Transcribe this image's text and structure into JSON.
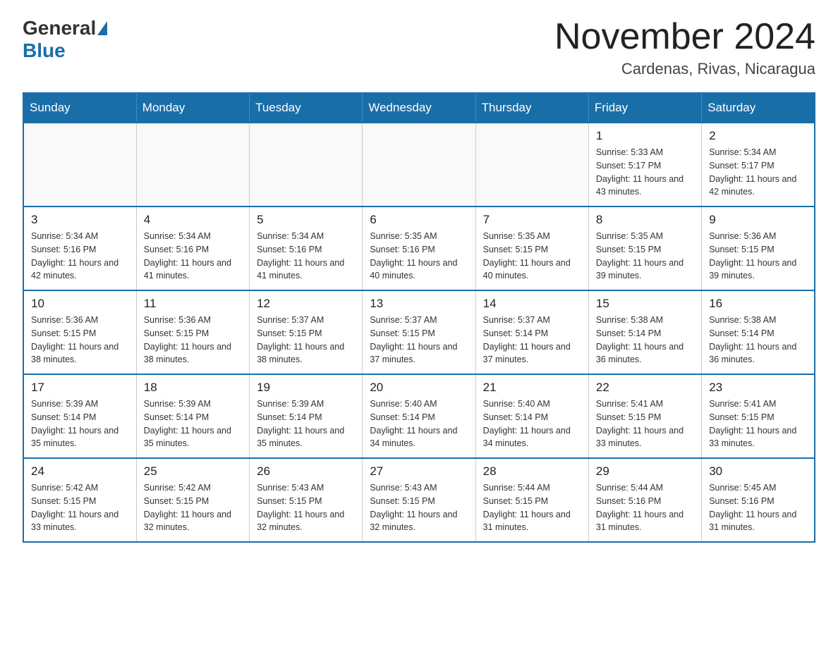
{
  "header": {
    "logo_general": "General",
    "logo_blue": "Blue",
    "month_title": "November 2024",
    "location": "Cardenas, Rivas, Nicaragua"
  },
  "weekdays": [
    "Sunday",
    "Monday",
    "Tuesday",
    "Wednesday",
    "Thursday",
    "Friday",
    "Saturday"
  ],
  "weeks": [
    [
      {
        "day": "",
        "info": ""
      },
      {
        "day": "",
        "info": ""
      },
      {
        "day": "",
        "info": ""
      },
      {
        "day": "",
        "info": ""
      },
      {
        "day": "",
        "info": ""
      },
      {
        "day": "1",
        "info": "Sunrise: 5:33 AM\nSunset: 5:17 PM\nDaylight: 11 hours and 43 minutes."
      },
      {
        "day": "2",
        "info": "Sunrise: 5:34 AM\nSunset: 5:17 PM\nDaylight: 11 hours and 42 minutes."
      }
    ],
    [
      {
        "day": "3",
        "info": "Sunrise: 5:34 AM\nSunset: 5:16 PM\nDaylight: 11 hours and 42 minutes."
      },
      {
        "day": "4",
        "info": "Sunrise: 5:34 AM\nSunset: 5:16 PM\nDaylight: 11 hours and 41 minutes."
      },
      {
        "day": "5",
        "info": "Sunrise: 5:34 AM\nSunset: 5:16 PM\nDaylight: 11 hours and 41 minutes."
      },
      {
        "day": "6",
        "info": "Sunrise: 5:35 AM\nSunset: 5:16 PM\nDaylight: 11 hours and 40 minutes."
      },
      {
        "day": "7",
        "info": "Sunrise: 5:35 AM\nSunset: 5:15 PM\nDaylight: 11 hours and 40 minutes."
      },
      {
        "day": "8",
        "info": "Sunrise: 5:35 AM\nSunset: 5:15 PM\nDaylight: 11 hours and 39 minutes."
      },
      {
        "day": "9",
        "info": "Sunrise: 5:36 AM\nSunset: 5:15 PM\nDaylight: 11 hours and 39 minutes."
      }
    ],
    [
      {
        "day": "10",
        "info": "Sunrise: 5:36 AM\nSunset: 5:15 PM\nDaylight: 11 hours and 38 minutes."
      },
      {
        "day": "11",
        "info": "Sunrise: 5:36 AM\nSunset: 5:15 PM\nDaylight: 11 hours and 38 minutes."
      },
      {
        "day": "12",
        "info": "Sunrise: 5:37 AM\nSunset: 5:15 PM\nDaylight: 11 hours and 38 minutes."
      },
      {
        "day": "13",
        "info": "Sunrise: 5:37 AM\nSunset: 5:15 PM\nDaylight: 11 hours and 37 minutes."
      },
      {
        "day": "14",
        "info": "Sunrise: 5:37 AM\nSunset: 5:14 PM\nDaylight: 11 hours and 37 minutes."
      },
      {
        "day": "15",
        "info": "Sunrise: 5:38 AM\nSunset: 5:14 PM\nDaylight: 11 hours and 36 minutes."
      },
      {
        "day": "16",
        "info": "Sunrise: 5:38 AM\nSunset: 5:14 PM\nDaylight: 11 hours and 36 minutes."
      }
    ],
    [
      {
        "day": "17",
        "info": "Sunrise: 5:39 AM\nSunset: 5:14 PM\nDaylight: 11 hours and 35 minutes."
      },
      {
        "day": "18",
        "info": "Sunrise: 5:39 AM\nSunset: 5:14 PM\nDaylight: 11 hours and 35 minutes."
      },
      {
        "day": "19",
        "info": "Sunrise: 5:39 AM\nSunset: 5:14 PM\nDaylight: 11 hours and 35 minutes."
      },
      {
        "day": "20",
        "info": "Sunrise: 5:40 AM\nSunset: 5:14 PM\nDaylight: 11 hours and 34 minutes."
      },
      {
        "day": "21",
        "info": "Sunrise: 5:40 AM\nSunset: 5:14 PM\nDaylight: 11 hours and 34 minutes."
      },
      {
        "day": "22",
        "info": "Sunrise: 5:41 AM\nSunset: 5:15 PM\nDaylight: 11 hours and 33 minutes."
      },
      {
        "day": "23",
        "info": "Sunrise: 5:41 AM\nSunset: 5:15 PM\nDaylight: 11 hours and 33 minutes."
      }
    ],
    [
      {
        "day": "24",
        "info": "Sunrise: 5:42 AM\nSunset: 5:15 PM\nDaylight: 11 hours and 33 minutes."
      },
      {
        "day": "25",
        "info": "Sunrise: 5:42 AM\nSunset: 5:15 PM\nDaylight: 11 hours and 32 minutes."
      },
      {
        "day": "26",
        "info": "Sunrise: 5:43 AM\nSunset: 5:15 PM\nDaylight: 11 hours and 32 minutes."
      },
      {
        "day": "27",
        "info": "Sunrise: 5:43 AM\nSunset: 5:15 PM\nDaylight: 11 hours and 32 minutes."
      },
      {
        "day": "28",
        "info": "Sunrise: 5:44 AM\nSunset: 5:15 PM\nDaylight: 11 hours and 31 minutes."
      },
      {
        "day": "29",
        "info": "Sunrise: 5:44 AM\nSunset: 5:16 PM\nDaylight: 11 hours and 31 minutes."
      },
      {
        "day": "30",
        "info": "Sunrise: 5:45 AM\nSunset: 5:16 PM\nDaylight: 11 hours and 31 minutes."
      }
    ]
  ]
}
